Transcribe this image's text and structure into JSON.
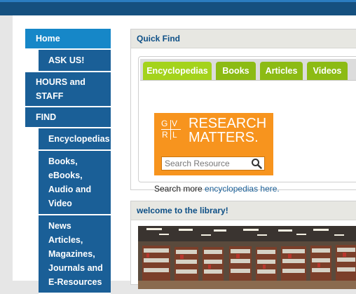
{
  "sidebar": {
    "items": [
      {
        "label": "Home"
      },
      {
        "label": "ASK US!"
      },
      {
        "label": "HOURS and STAFF"
      },
      {
        "label": "FIND"
      },
      {
        "label": "Encyclopedias"
      },
      {
        "label": "Books, eBooks, Audio and Video"
      },
      {
        "label": "News Articles, Magazines, Journals and E-Resources"
      }
    ]
  },
  "quick_find": {
    "title": "Quick Find",
    "tabs": [
      {
        "label": "Encyclopedias",
        "active": true
      },
      {
        "label": "Books"
      },
      {
        "label": "Articles"
      },
      {
        "label": "Videos"
      }
    ],
    "gvrl": {
      "logo_text": "GVRL",
      "title": "RESEARCH\nMATTERS.",
      "search_placeholder": "Search Resource"
    },
    "search_more_prefix": "Search more ",
    "search_more_link": "encyclopedias here."
  },
  "welcome": {
    "title": "welcome to the library!"
  },
  "colors": {
    "topbar": "#15507f",
    "nav": "#1a5f97",
    "nav_active": "#1687c8",
    "tab": "#8cbb14",
    "gvrl_orange": "#f7941e",
    "panel_title": "#0d4f86"
  }
}
